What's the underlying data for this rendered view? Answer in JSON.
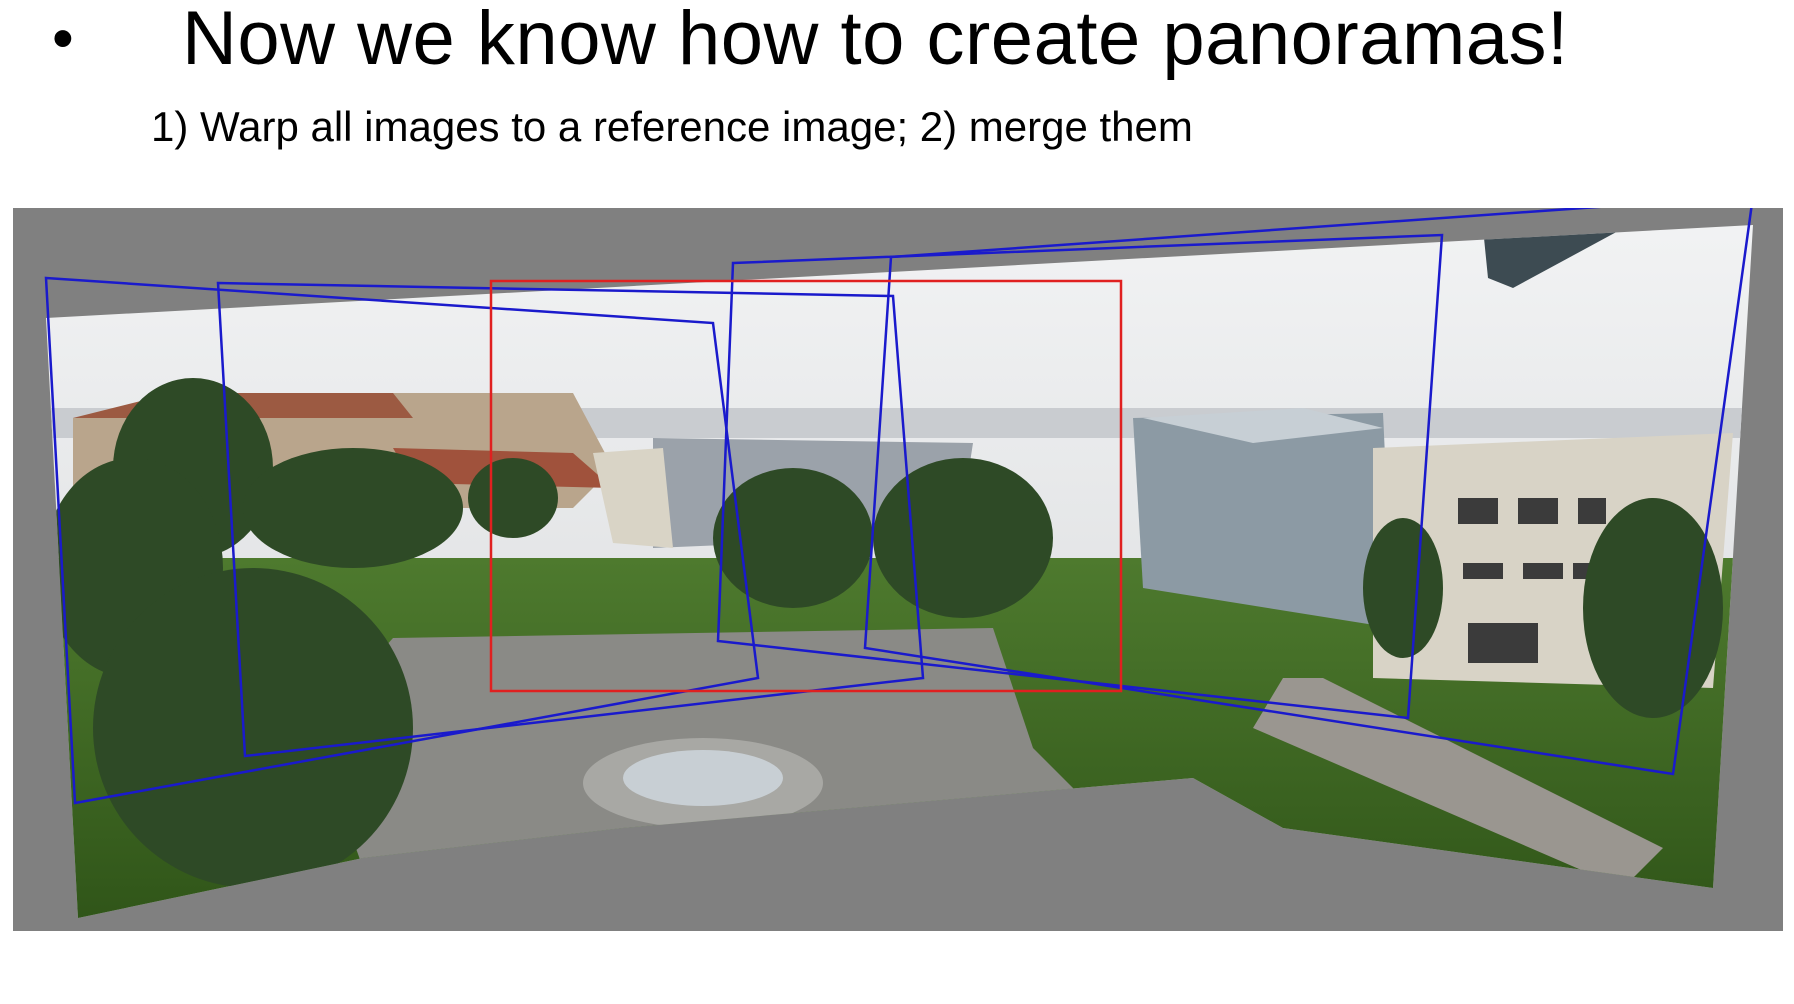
{
  "slide": {
    "bullet": "•",
    "title": "Now we know how to create panoramas!",
    "subtitle": "1) Warp all images to a reference image; 2) merge them"
  },
  "figure": {
    "background_color": "#808080",
    "reference_frame_color": "#e02020",
    "warped_frame_color": "#1a1acc"
  }
}
